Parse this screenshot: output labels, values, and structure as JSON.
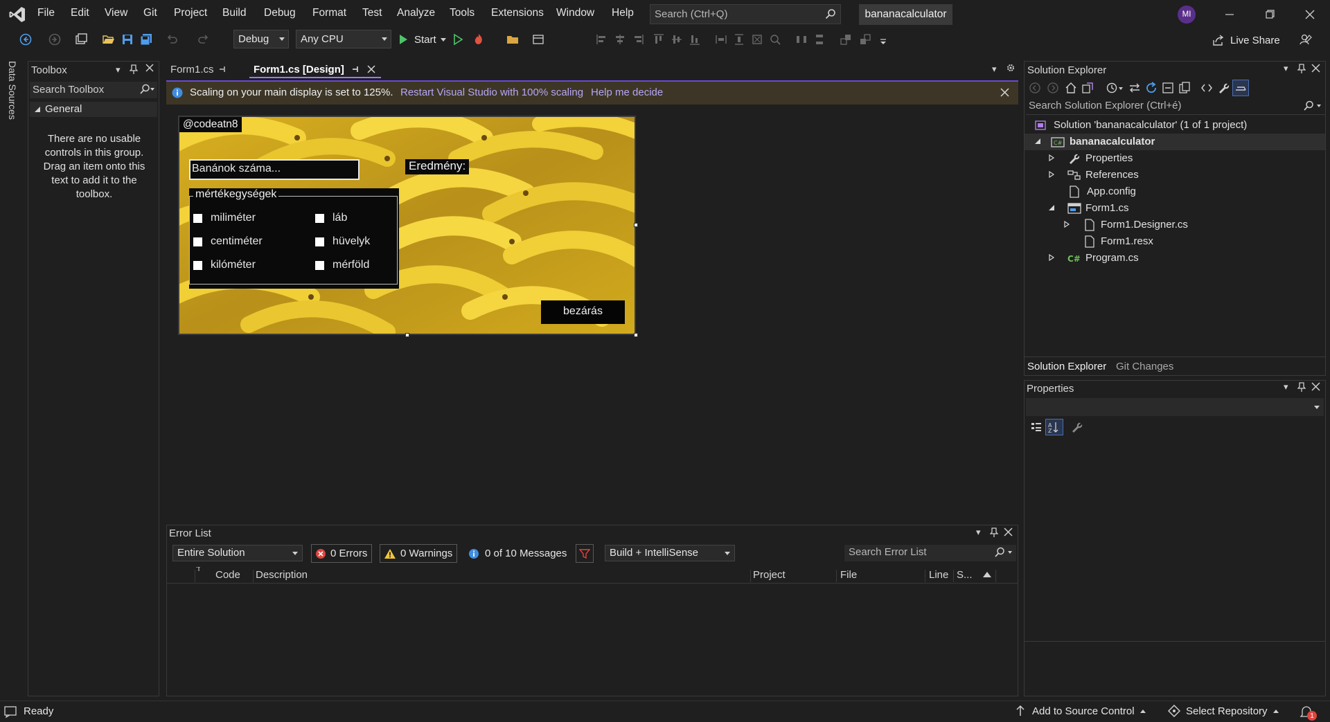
{
  "titlebar": {
    "menu": [
      "File",
      "Edit",
      "View",
      "Git",
      "Project",
      "Build",
      "Debug",
      "Format",
      "Test",
      "Analyze",
      "Tools",
      "Extensions",
      "Window",
      "Help"
    ],
    "search_placeholder": "Search (Ctrl+Q)",
    "project_name": "bananacalculator",
    "avatar_initials": "MI"
  },
  "toolbar": {
    "config": "Debug",
    "platform": "Any CPU",
    "start_label": "Start",
    "live_share": "Live Share"
  },
  "left_tab": {
    "label": "Data Sources"
  },
  "toolbox": {
    "title": "Toolbox",
    "search_placeholder": "Search Toolbox",
    "group": "General",
    "empty_message": "There are no usable controls in this group. Drag an item onto this text to add it to the toolbox."
  },
  "doc_tabs": [
    {
      "label": "Form1.cs",
      "active": false
    },
    {
      "label": "Form1.cs [Design]",
      "active": true
    }
  ],
  "infobar": {
    "message": "Scaling on your main display is set to 125%.",
    "link1": "Restart Visual Studio with 100% scaling",
    "link2": "Help me decide"
  },
  "form": {
    "watermark": "@codeatn8",
    "input_placeholder": "Banánok száma...",
    "result_label": "Eredmény:",
    "group_title": "mértékegységek",
    "checkboxes_left": [
      "miliméter",
      "centiméter",
      "kilóméter"
    ],
    "checkboxes_right": [
      "láb",
      "hüvelyk",
      "mérföld"
    ],
    "close_button": "bezárás"
  },
  "error_list": {
    "title": "Error List",
    "scope": "Entire Solution",
    "errors": "0 Errors",
    "warnings": "0 Warnings",
    "messages": "0 of 10 Messages",
    "build_filter": "Build + IntelliSense",
    "search_placeholder": "Search Error List",
    "columns": [
      "Code",
      "Description",
      "Project",
      "File",
      "Line",
      "S..."
    ]
  },
  "solution_explorer": {
    "title": "Solution Explorer",
    "search_placeholder": "Search Solution Explorer (Ctrl+é)",
    "solution": "Solution 'bananacalculator' (1 of 1 project)",
    "project": "bananacalculator",
    "items": [
      "Properties",
      "References",
      "App.config",
      "Form1.cs",
      "Form1.Designer.cs",
      "Form1.resx",
      "Program.cs"
    ],
    "tabs": [
      "Solution Explorer",
      "Git Changes"
    ]
  },
  "properties": {
    "title": "Properties"
  },
  "statusbar": {
    "ready": "Ready",
    "source_control": "Add to Source Control",
    "repository": "Select Repository",
    "notifications": "1"
  }
}
